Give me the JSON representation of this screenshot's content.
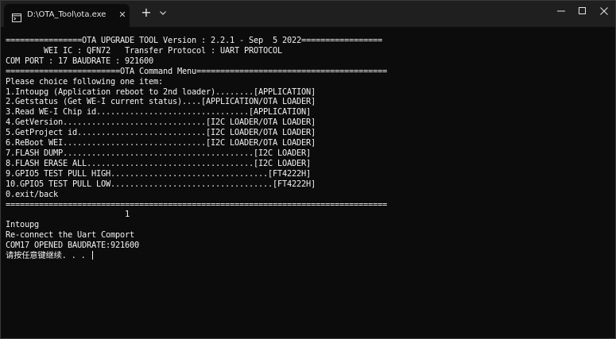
{
  "window": {
    "tab_title": "D:\\OTA_Tool\\ota.exe",
    "tab_close_glyph": "✕",
    "new_tab_glyph": "+",
    "icons": {
      "tab": "terminal-icon",
      "close": "close-icon",
      "new_tab": "plus-icon",
      "dropdown": "chevron-down-icon",
      "minimize": "minimize-icon",
      "maximize": "maximize-icon",
      "window_close": "close-icon"
    }
  },
  "terminal": {
    "lines": [
      "================OTA UPGRADE TOOL Version : 2.2.1 - Sep  5 2022=================",
      "        WEI IC : QFN72   Transfer Protocol : UART PROTOCOL",
      "COM PORT : 17 BAUDRATE : 921600",
      "========================OTA Command Menu========================================",
      "Please choice following one item:",
      "1.Intoupg (Application reboot to 2nd loader)........[APPLICATION]",
      "2.Getstatus (Get WE-I current status)....[APPLICATION/OTA LOADER]",
      "3.Read WE-I Chip id................................[APPLICATION]",
      "4.GetVersion..............................[I2C LOADER/OTA LOADER]",
      "5.GetProject id...........................[I2C LOADER/OTA LOADER]",
      "6.ReBoot WEI..............................[I2C LOADER/OTA LOADER]",
      "7.FLASH DUMP........................................[I2C LOADER]",
      "8.FLASH ERASE ALL...................................[I2C LOADER]",
      "9.GPIO5 TEST PULL HIGH.................................[FT4222H]",
      "10.GPIO5 TEST PULL LOW..................................[FT4222H]",
      "0.exit/back",
      "================================================================================",
      "                         1",
      "Intoupg",
      "Re-connect the Uart Comport",
      "COM17 OPENED BAUDRATE:921600",
      "请按任意键继续. . . "
    ]
  },
  "colors": {
    "terminal_bg": "#0c0c0c",
    "titlebar_bg": "#1f1f1f",
    "text": "#f2f2f2"
  }
}
